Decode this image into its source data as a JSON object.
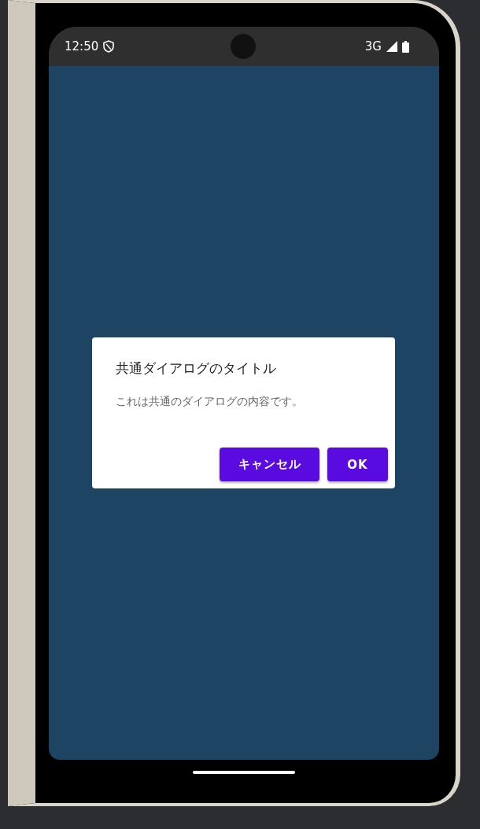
{
  "status_bar": {
    "time": "12:50",
    "network": "3G"
  },
  "dialog": {
    "title": "共通ダイアログのタイトル",
    "message": "これは共通のダイアログの内容です。",
    "buttons": [
      {
        "label": "キャンセル"
      },
      {
        "label": "OK"
      }
    ]
  }
}
